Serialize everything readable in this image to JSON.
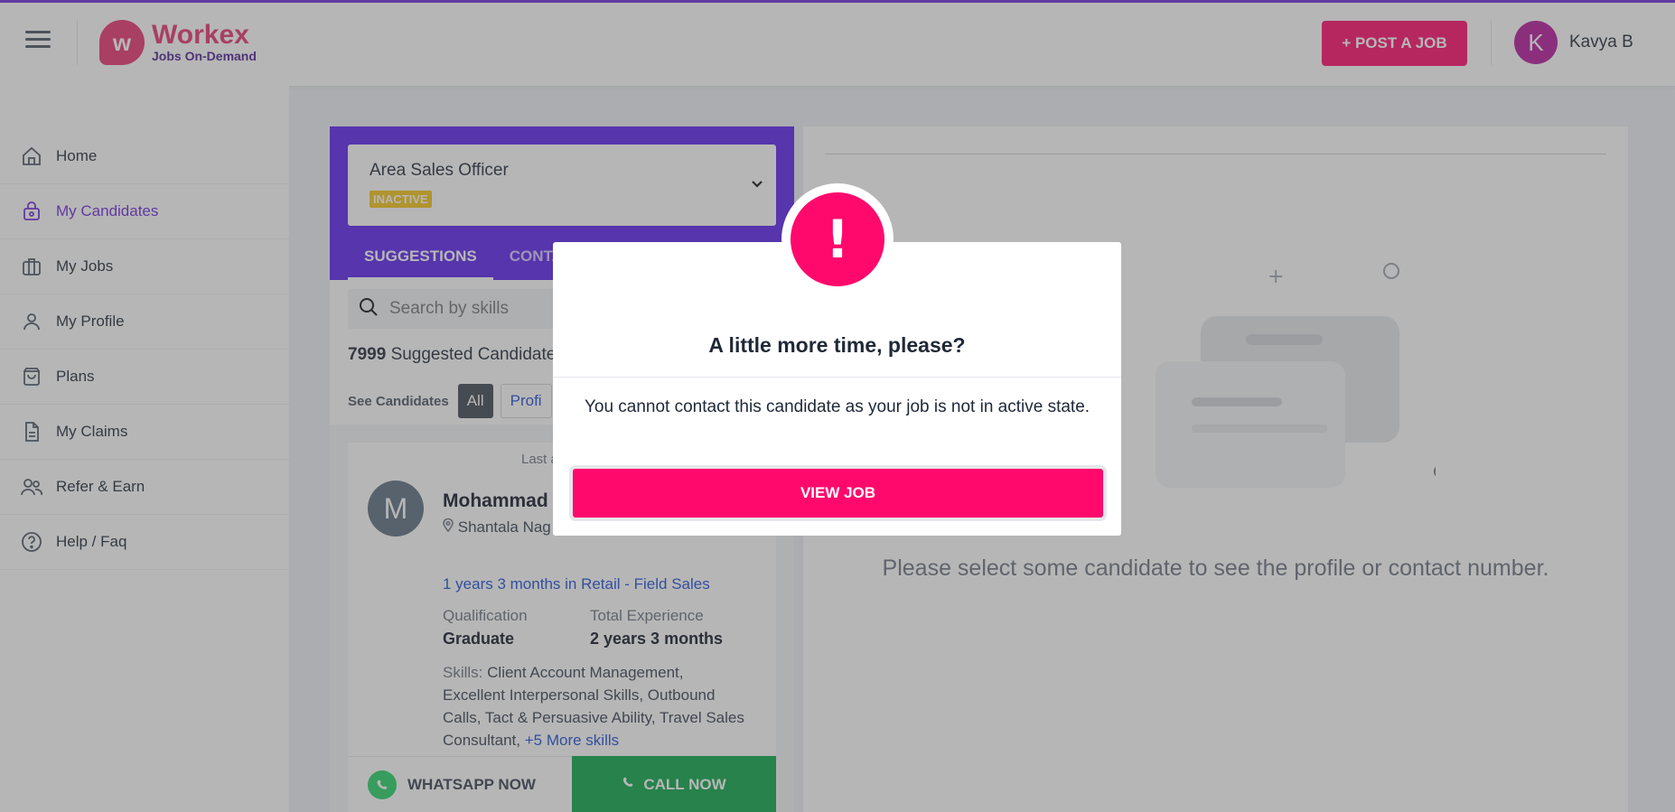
{
  "header": {
    "logo_name": "Workex",
    "logo_tagline": "Jobs On-Demand",
    "post_job_label": "+ POST A JOB",
    "user_initial": "K",
    "user_name": "Kavya B"
  },
  "sidebar": {
    "items": [
      {
        "label": "Home",
        "icon": "home-icon"
      },
      {
        "label": "My Candidates",
        "icon": "lock-bag-icon",
        "active": true
      },
      {
        "label": "My Jobs",
        "icon": "briefcase-icon"
      },
      {
        "label": "My Profile",
        "icon": "user-icon"
      },
      {
        "label": "Plans",
        "icon": "shopping-bag-icon"
      },
      {
        "label": "My Claims",
        "icon": "document-icon"
      },
      {
        "label": "Refer & Earn",
        "icon": "users-icon"
      },
      {
        "label": "Help / Faq",
        "icon": "help-icon"
      }
    ]
  },
  "job": {
    "title": "Area Sales Officer",
    "status": "INACTIVE"
  },
  "tabs": [
    "SUGGESTIONS",
    "CONTA"
  ],
  "search": {
    "placeholder": "Search by skills"
  },
  "suggested": {
    "count": "7999",
    "label": "Suggested Candidate"
  },
  "filters": {
    "label": "See Candidates",
    "all": "All",
    "profile": "Profi"
  },
  "candidate": {
    "initial": "M",
    "last_active": "Last a",
    "name": "Mohammad",
    "location": "Shantala Nag",
    "experience_line": "1 years 3 months in Retail - Field Sales",
    "qualification_label": "Qualification",
    "qualification": "Graduate",
    "total_exp_label": "Total Experience",
    "total_exp": "2 years 3 months",
    "skills_label": "Skills:",
    "skills": "Client Account Management, Excellent Interpersonal Skills, Outbound Calls, Tact & Persuasive Ability, Travel Sales Consultant,",
    "more_skills": "+5 More skills",
    "whatsapp_label": "WHATSAPP NOW",
    "call_label": "CALL NOW"
  },
  "right_panel": {
    "message": "Please select some candidate to see the profile or contact number."
  },
  "modal": {
    "title": "A little more time, please?",
    "message": "You cannot contact this candidate as your job is not in active state.",
    "button": "VIEW JOB"
  },
  "colors": {
    "brand_pink": "#ff0a6c",
    "brand_purple": "#5b21f0",
    "active_nav": "#6d28d9",
    "call_green": "#0aa548"
  }
}
